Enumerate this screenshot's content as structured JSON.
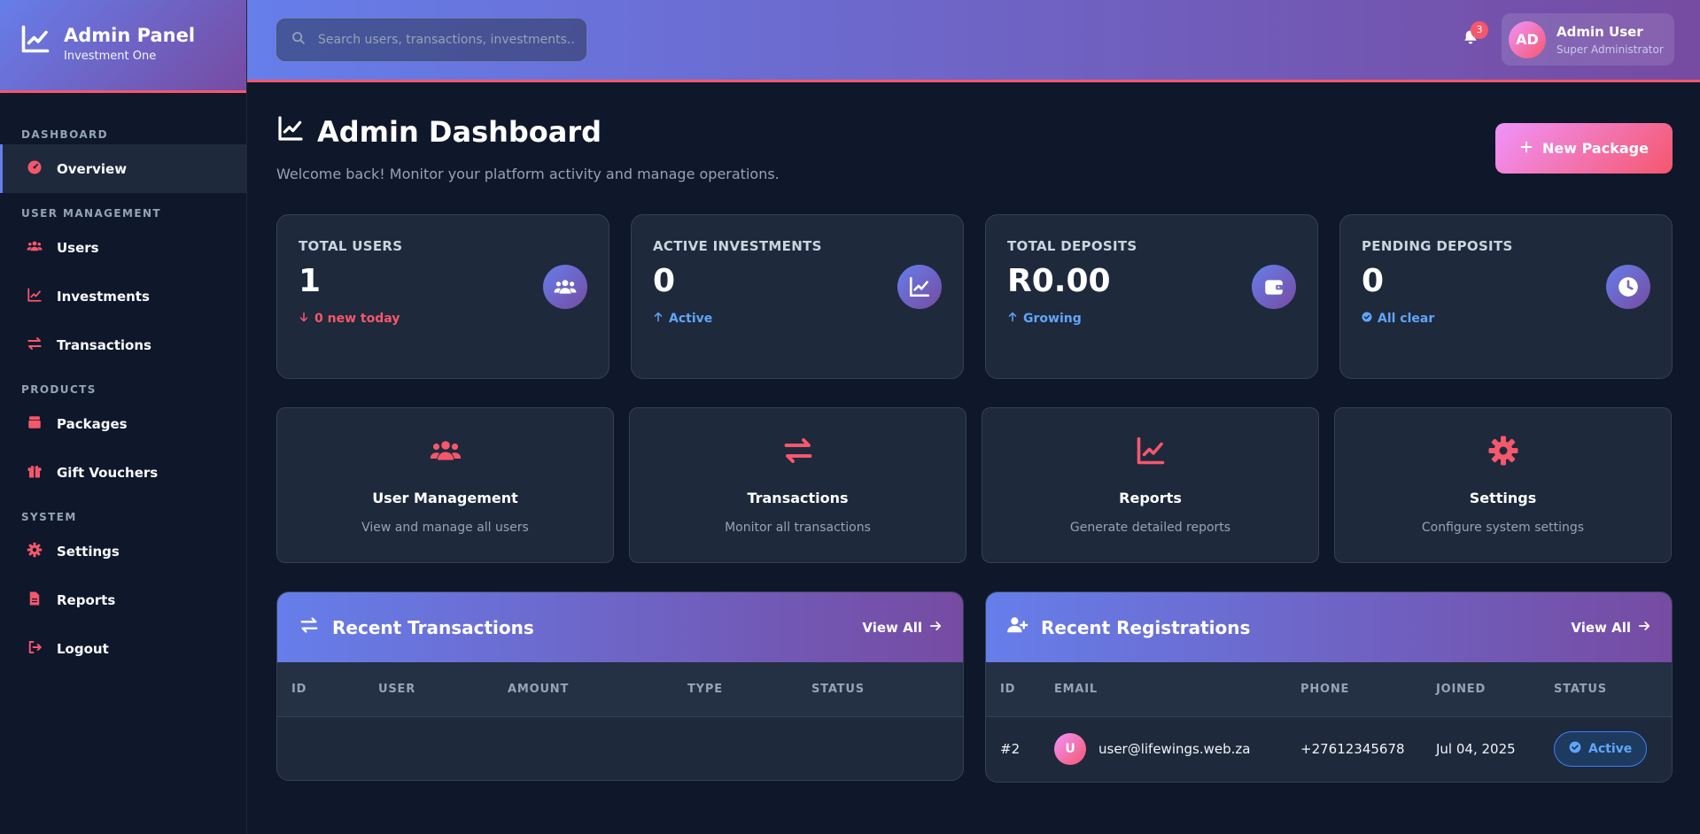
{
  "brand": {
    "title": "Admin Panel",
    "subtitle": "Investment One"
  },
  "sidebar": {
    "sections": [
      {
        "label": "DASHBOARD",
        "items": [
          {
            "label": "Overview",
            "icon": "gauge-icon",
            "active": true
          }
        ]
      },
      {
        "label": "USER MANAGEMENT",
        "items": [
          {
            "label": "Users",
            "icon": "users-icon"
          },
          {
            "label": "Investments",
            "icon": "chart-line-icon"
          },
          {
            "label": "Transactions",
            "icon": "exchange-icon"
          }
        ]
      },
      {
        "label": "PRODUCTS",
        "items": [
          {
            "label": "Packages",
            "icon": "box-icon"
          },
          {
            "label": "Gift Vouchers",
            "icon": "gift-icon"
          }
        ]
      },
      {
        "label": "SYSTEM",
        "items": [
          {
            "label": "Settings",
            "icon": "gear-icon"
          },
          {
            "label": "Reports",
            "icon": "file-icon"
          },
          {
            "label": "Logout",
            "icon": "logout-icon"
          }
        ]
      }
    ]
  },
  "header": {
    "search_placeholder": "Search users, transactions, investments...",
    "notification_count": "3",
    "user": {
      "initials": "AD",
      "name": "Admin User",
      "role": "Super Administrator"
    }
  },
  "page": {
    "title": "Admin Dashboard",
    "subtitle": "Welcome back! Monitor your platform activity and manage operations.",
    "new_button": "New Package"
  },
  "stats": [
    {
      "label": "TOTAL USERS",
      "value": "1",
      "trend": "0 new today",
      "trend_color": "#f5576c",
      "trend_icon": "arrow-down-icon",
      "icon": "users-icon"
    },
    {
      "label": "ACTIVE INVESTMENTS",
      "value": "0",
      "trend": "Active",
      "trend_color": "#60a5fa",
      "trend_icon": "arrow-up-icon",
      "icon": "chart-line-icon"
    },
    {
      "label": "TOTAL DEPOSITS",
      "value": "R0.00",
      "trend": "Growing",
      "trend_color": "#60a5fa",
      "trend_icon": "arrow-up-icon",
      "icon": "wallet-icon"
    },
    {
      "label": "PENDING DEPOSITS",
      "value": "0",
      "trend": "All clear",
      "trend_color": "#60a5fa",
      "trend_icon": "check-circle-icon",
      "icon": "clock-icon"
    }
  ],
  "actions": [
    {
      "title": "User Management",
      "desc": "View and manage all users",
      "icon": "users-icon"
    },
    {
      "title": "Transactions",
      "desc": "Monitor all transactions",
      "icon": "exchange-icon"
    },
    {
      "title": "Reports",
      "desc": "Generate detailed reports",
      "icon": "chart-line-icon"
    },
    {
      "title": "Settings",
      "desc": "Configure system settings",
      "icon": "gear-icon"
    }
  ],
  "recent_transactions": {
    "title": "Recent Transactions",
    "view_all": "View All",
    "columns": [
      "ID",
      "USER",
      "AMOUNT",
      "TYPE",
      "STATUS"
    ],
    "rows": []
  },
  "recent_registrations": {
    "title": "Recent Registrations",
    "view_all": "View All",
    "columns": [
      "ID",
      "EMAIL",
      "PHONE",
      "JOINED",
      "STATUS"
    ],
    "rows": [
      {
        "id": "#2",
        "initial": "U",
        "email": "user@lifewings.web.za",
        "phone": "+27612345678",
        "joined": "Jul 04, 2025",
        "status": "Active"
      }
    ]
  },
  "colors": {
    "accent_gradient_start": "#667eea",
    "accent_gradient_end": "#764ba2",
    "pink": "#f5576c",
    "pink_light": "#f093fb",
    "bg": "#0f172a",
    "card": "#1e293b"
  }
}
